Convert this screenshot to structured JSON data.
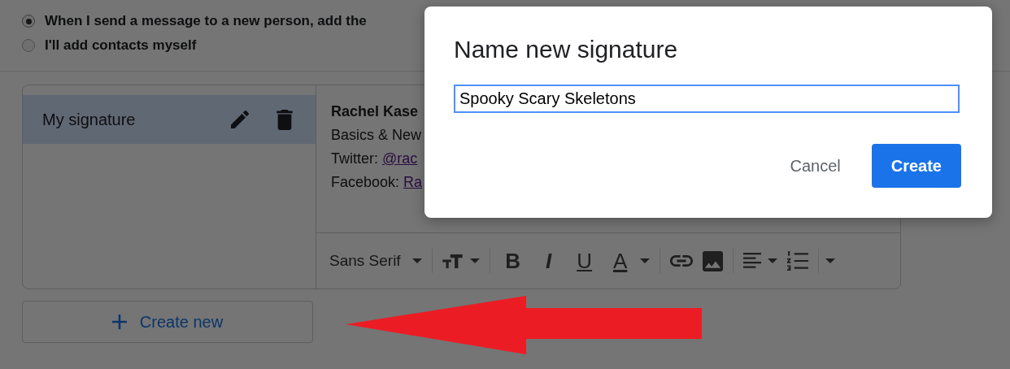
{
  "radio_options": [
    {
      "label": "When I send a message to a new person, add the",
      "selected": true
    },
    {
      "label": "I'll add contacts myself",
      "selected": false
    }
  ],
  "signatures": [
    {
      "name": "My signature",
      "selected": true
    }
  ],
  "signature_preview": {
    "name": "Rachel Kase",
    "lines": [
      {
        "label": "Basics & New"
      },
      {
        "label": "Twitter: ",
        "link": "@rac"
      },
      {
        "label": "Facebook: ",
        "link": "Ra"
      }
    ]
  },
  "toolbar": {
    "font": "Sans Serif",
    "format_keys": [
      {
        "glyph": "B",
        "kind": "bold"
      },
      {
        "glyph": "I",
        "kind": "italic"
      },
      {
        "glyph": "U",
        "kind": "underline"
      },
      {
        "glyph": "A",
        "kind": "color"
      }
    ]
  },
  "create_button": "Create new",
  "dialog": {
    "title": "Name new signature",
    "input_value": "Spooky Scary Skeletons",
    "buttons": [
      {
        "label": "Cancel",
        "kind": "text"
      },
      {
        "label": "Create",
        "kind": "primary"
      }
    ]
  }
}
